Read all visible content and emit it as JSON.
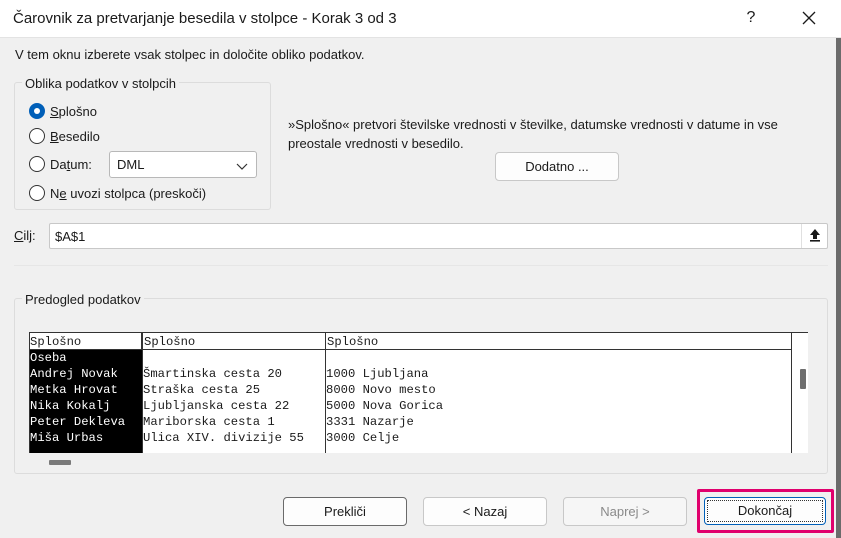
{
  "window": {
    "title": "Čarovnik za pretvarjanje besedila v stolpce - Korak 3 od 3",
    "help_label": "?"
  },
  "intro_text": "V tem oknu izberete vsak stolpec in določite obliko podatkov.",
  "format_group": {
    "legend": "Oblika podatkov v stolpcih",
    "options": [
      {
        "label": "Splošno",
        "selected": true
      },
      {
        "label": "Besedilo",
        "selected": false
      },
      {
        "label": "Datum:",
        "selected": false
      },
      {
        "label": "Ne uvozi stolpca (preskoči)",
        "selected": false
      }
    ],
    "date_format": "DML"
  },
  "description": "»Splošno« pretvori številske vrednosti v številke, datumske vrednosti v datume in vse preostale vrednosti v besedilo.",
  "advanced_button": "Dodatno ...",
  "destination": {
    "label": "Cilj:",
    "value": "$A$1"
  },
  "preview": {
    "legend": "Predogled podatkov",
    "columns": [
      {
        "header": "Splošno",
        "cells": [
          "Oseba",
          "Andrej Novak",
          "Metka Hrovat",
          "Nika Kokalj",
          "Peter Dekleva",
          "Miša Urbas"
        ]
      },
      {
        "header": "Splošno",
        "cells": [
          "",
          "Šmartinska cesta 20",
          "Straška cesta 25",
          "Ljubljanska cesta 22",
          "Mariborska cesta 1",
          "Ulica XIV. divizije 55"
        ]
      },
      {
        "header": "Splošno",
        "cells": [
          "",
          "1000 Ljubljana",
          "8000 Novo mesto",
          "5000 Nova Gorica",
          "3331 Nazarje",
          "3000 Celje"
        ]
      }
    ]
  },
  "buttons": {
    "cancel": "Prekliči",
    "back": "< Nazaj",
    "next": "Naprej >",
    "finish": "Dokončaj"
  },
  "colors": {
    "accent": "#005fb8",
    "highlight": "#e0006d"
  }
}
